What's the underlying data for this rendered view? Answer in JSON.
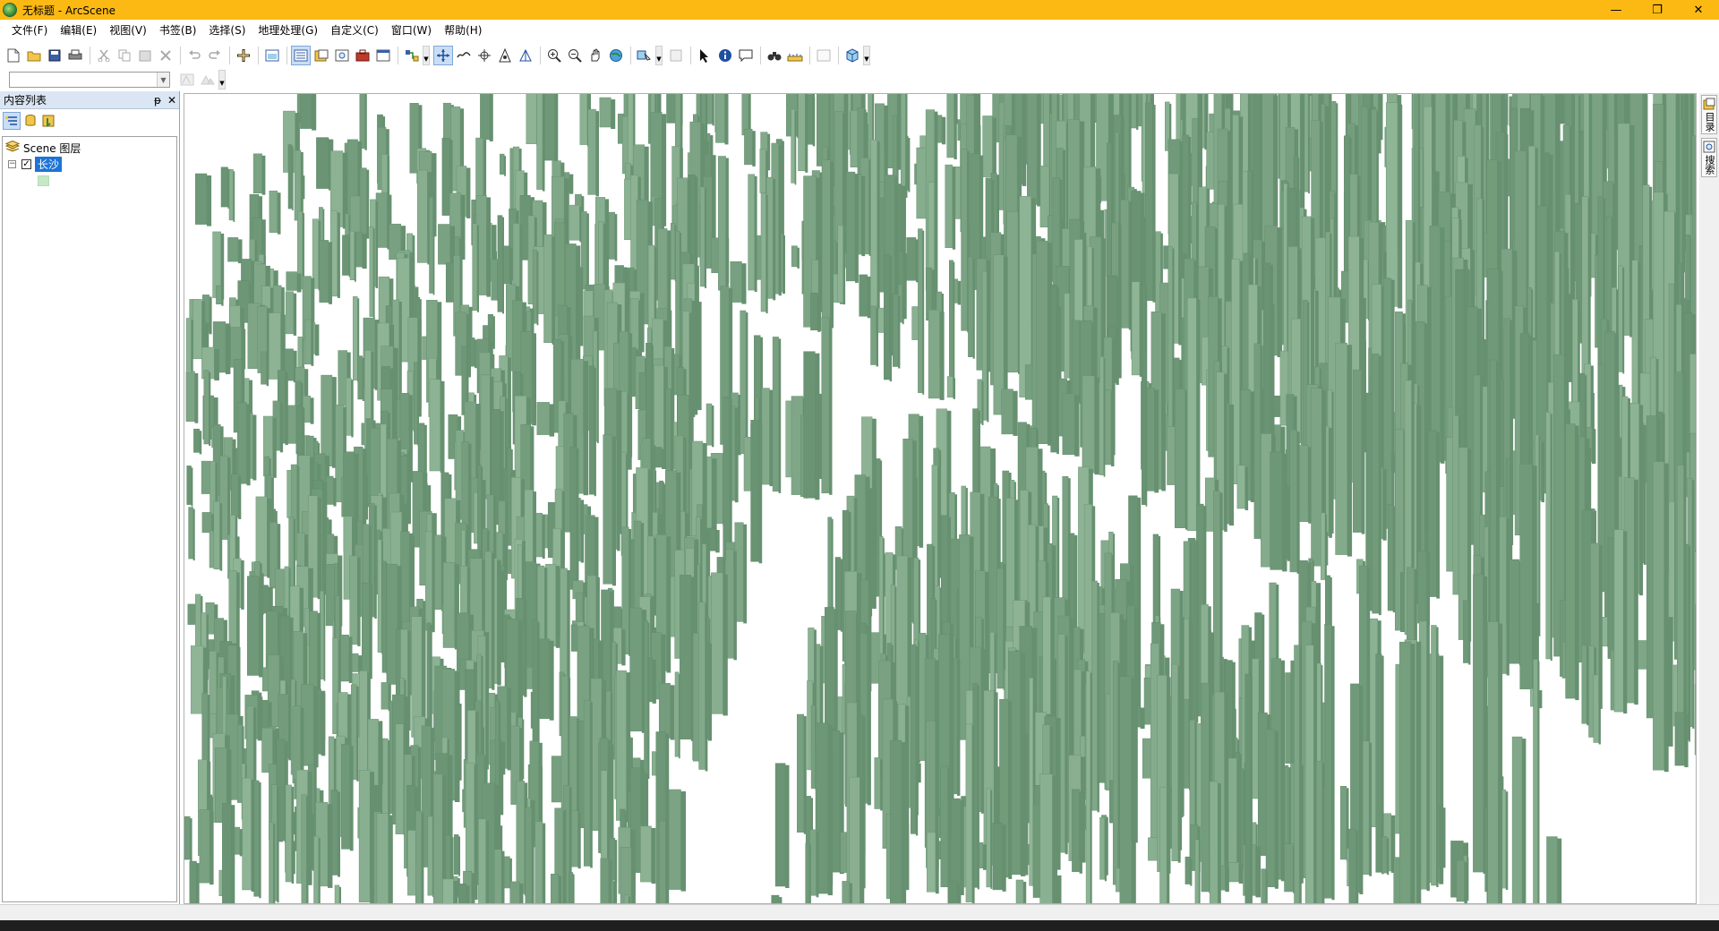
{
  "window": {
    "title": "无标题 - ArcScene",
    "controls": {
      "minimize": "—",
      "restore": "❐",
      "close": "✕"
    }
  },
  "menu": {
    "items": [
      "文件(F)",
      "编辑(E)",
      "视图(V)",
      "书签(B)",
      "选择(S)",
      "地理处理(G)",
      "自定义(C)",
      "窗口(W)",
      "帮助(H)"
    ]
  },
  "toc": {
    "title": "内容列表",
    "pin": "ᵽ",
    "close": "✕",
    "root_label": "Scene 图层",
    "layer_label": "长沙",
    "layer_checked": "✓",
    "expander": "−",
    "swatch_color": "#c5e9c8"
  },
  "right_dock": {
    "tabs": [
      "目录",
      "搜索"
    ]
  },
  "scene": {
    "building_color": "#8fb596",
    "building_shadow": "#5f8a69",
    "background": "#ffffff"
  }
}
